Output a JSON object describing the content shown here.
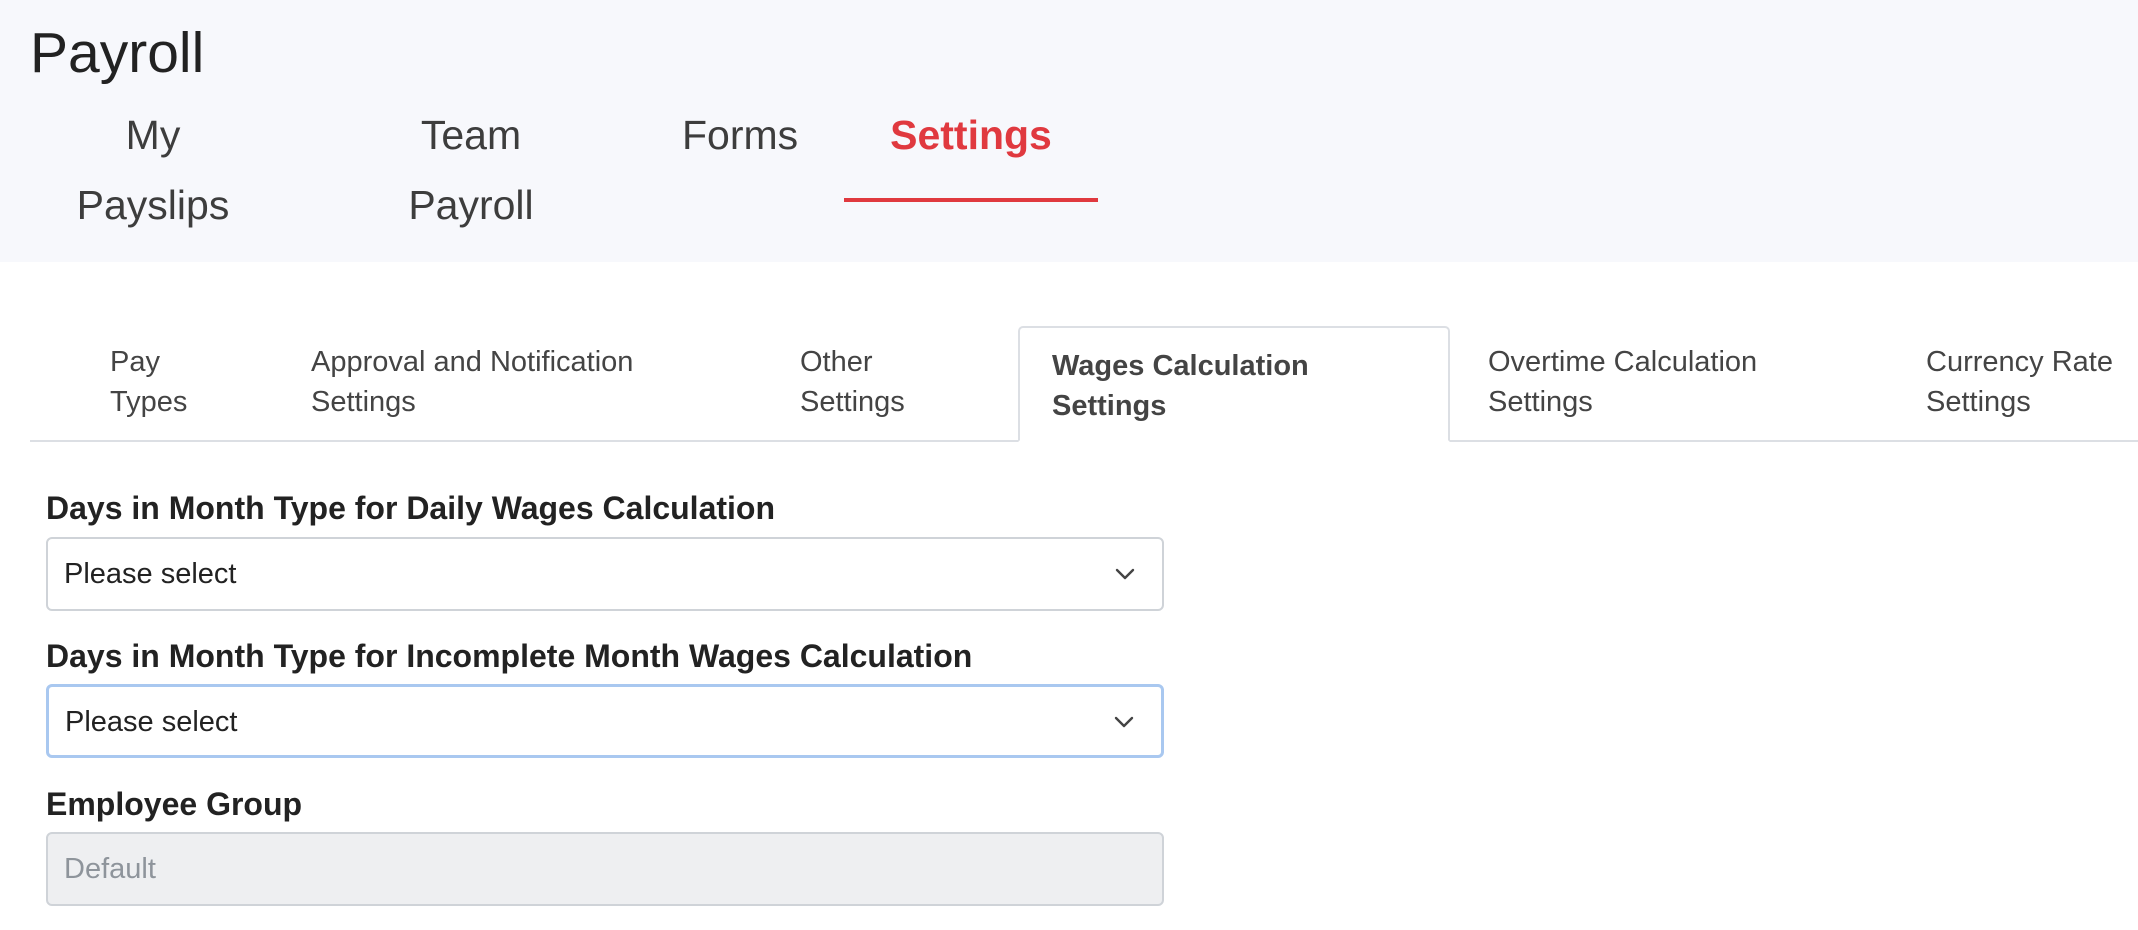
{
  "app": {
    "title": "Payroll"
  },
  "main_nav": {
    "tabs": [
      {
        "label": "My Payslips",
        "active": false
      },
      {
        "label": "Team Payroll",
        "active": false
      },
      {
        "label": "Forms",
        "active": false
      },
      {
        "label": "Settings",
        "active": true
      }
    ]
  },
  "sub_tabs": [
    {
      "line1": "Pay",
      "line2": "Types",
      "active": false
    },
    {
      "line1": "Approval and Notification",
      "line2": "Settings",
      "active": false
    },
    {
      "line1": "Other",
      "line2": "Settings",
      "active": false
    },
    {
      "line1": "Wages Calculation",
      "line2": "Settings",
      "active": true
    },
    {
      "line1": "Overtime Calculation",
      "line2": "Settings",
      "active": false
    },
    {
      "line1": "Currency Rate",
      "line2": "Settings",
      "active": false
    }
  ],
  "form": {
    "daily_wages": {
      "label": "Days in Month Type for Daily Wages Calculation",
      "value": "Please select"
    },
    "incomplete_month": {
      "label": "Days in Month Type for Incomplete Month Wages Calculation",
      "value": "Please select"
    },
    "employee_group": {
      "label": "Employee Group",
      "placeholder": "Default"
    }
  },
  "colors": {
    "accent": "#e0393f",
    "header_bg": "#f7f8fc",
    "focus_border": "#a9c8f0"
  },
  "icons": {
    "select_chevron": "chevron-down-icon"
  }
}
